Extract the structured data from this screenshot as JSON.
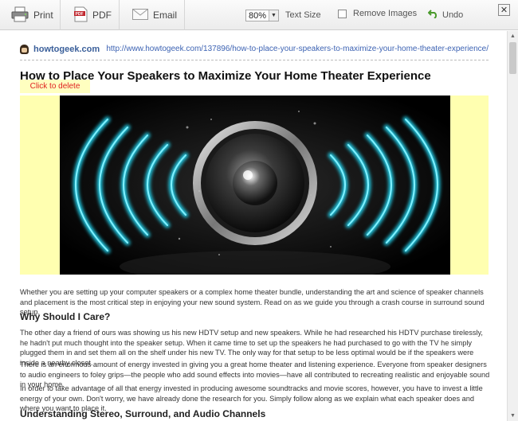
{
  "toolbar": {
    "print_label": "Print",
    "pdf_label": "PDF",
    "email_label": "Email",
    "zoom_value": "80%",
    "text_size_label": "Text Size",
    "remove_images_label": "Remove Images",
    "remove_images_checked": false,
    "undo_label": "Undo",
    "close_label": "✕"
  },
  "source": {
    "site_name": "howtogeek.com",
    "url": "http://www.howtogeek.com/137896/how-to-place-your-speakers-to-maximize-your-home-theater-experience/"
  },
  "article": {
    "title": "How to Place Your Speakers to Maximize Your Home Theater Experience",
    "delete_hint": "Click to delete",
    "intro": "Whether you are setting up your computer speakers or a complex home theater bundle, understanding the art and science of speaker channels and placement is the most critical step in enjoying your new sound system. Read on as we guide you through a crash course in surround sound setup.",
    "section1_heading": "Why Should I Care?",
    "para1": "The other day a friend of ours was showing us his new HDTV setup and new speakers. While he had researched his HDTV purchase tirelessly, he hadn't put much thought into the speaker setup. When it came time to set up the speakers he had purchased to go with the TV he simply plugged them in and set them all on the shelf under his new TV. The only way for that setup to be less optimal would be if the speakers were inside a nearby closet.",
    "para2": "There is an enormous amount of energy invested in giving you a great home theater and listening experience. Everyone from speaker designers to audio engineers to foley grips—the people who add sound effects into movies—have all contributed to recreating realistic and enjoyable sound in your home.",
    "para3": "In order to take advantage of all that energy invested in producing awesome soundtracks and movie scores, however, you have to invest a little energy of your own. Don't worry, we have already done the research for you. Simply follow along as we explain what each speaker does and where you want to place it.",
    "section2_heading": "Understanding Stereo, Surround, and Audio Channels"
  },
  "colors": {
    "accent_link": "#3d63b3",
    "delete_text": "#e02020",
    "highlight_bg": "#ffffb0",
    "wave_cyan": "#22d3ee"
  }
}
